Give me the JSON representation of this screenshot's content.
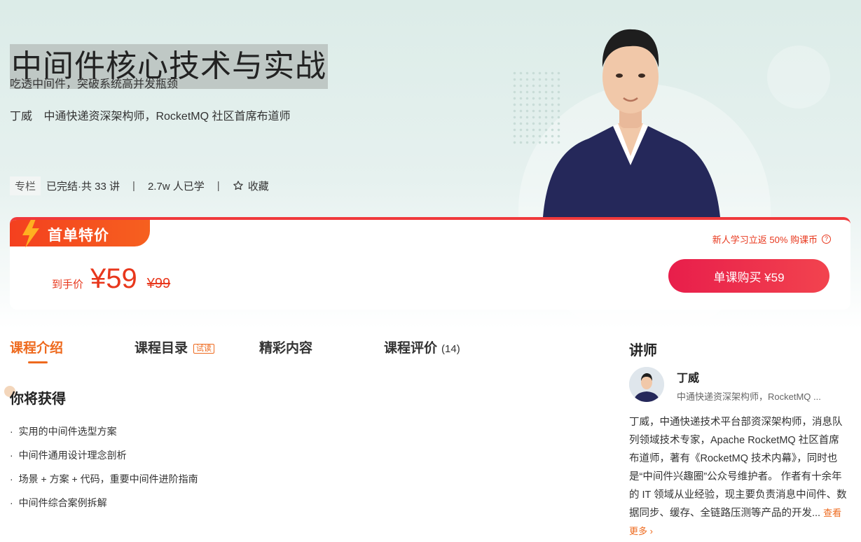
{
  "course": {
    "title": "中间件核心技术与实战",
    "subtitle": "吃透中间件，突破系统高并发瓶颈",
    "author_name": "丁威",
    "author_title": "中通快递资深架构师，RocketMQ 社区首席布道师",
    "badge": "专栏",
    "status": "已完结·共 33 讲",
    "learners": "2.7w 人已学",
    "favorite_label": "收藏"
  },
  "price": {
    "promo_label": "首单特价",
    "new_user_note": "新人学习立返 50% 购课币",
    "final_label": "到手价",
    "current": "¥59",
    "original": "¥99",
    "buy_button": "单课购买 ¥59"
  },
  "tabs": [
    {
      "label": "课程介绍",
      "active": true
    },
    {
      "label": "课程目录",
      "tag": "试读"
    },
    {
      "label": "精彩内容"
    },
    {
      "label": "课程评价",
      "count": "(14)"
    }
  ],
  "gains": {
    "title": "你将获得",
    "items": [
      "实用的中间件选型方案",
      "中间件通用设计理念剖析",
      "场景 + 方案 + 代码，重要中间件进阶指南",
      "中间件综合案例拆解"
    ]
  },
  "teacher": {
    "section_title": "讲师",
    "name": "丁威",
    "role": "中通快递资深架构师，RocketMQ ...",
    "bio": "丁威，中通快递技术平台部资深架构师，消息队列领域技术专家，Apache RocketMQ 社区首席布道师，著有《RocketMQ 技术内幕》，同时也是“中间件兴趣圈”公众号维护者。 作者有十余年的 IT 领域从业经验，现主要负责消息中间件、数据同步、缓存、全链路压测等产品的开发...",
    "more_label": "查看更多"
  },
  "colors": {
    "accent": "#ee6a1e",
    "price_red": "#e8371c",
    "button_red": "#e81e4b"
  }
}
